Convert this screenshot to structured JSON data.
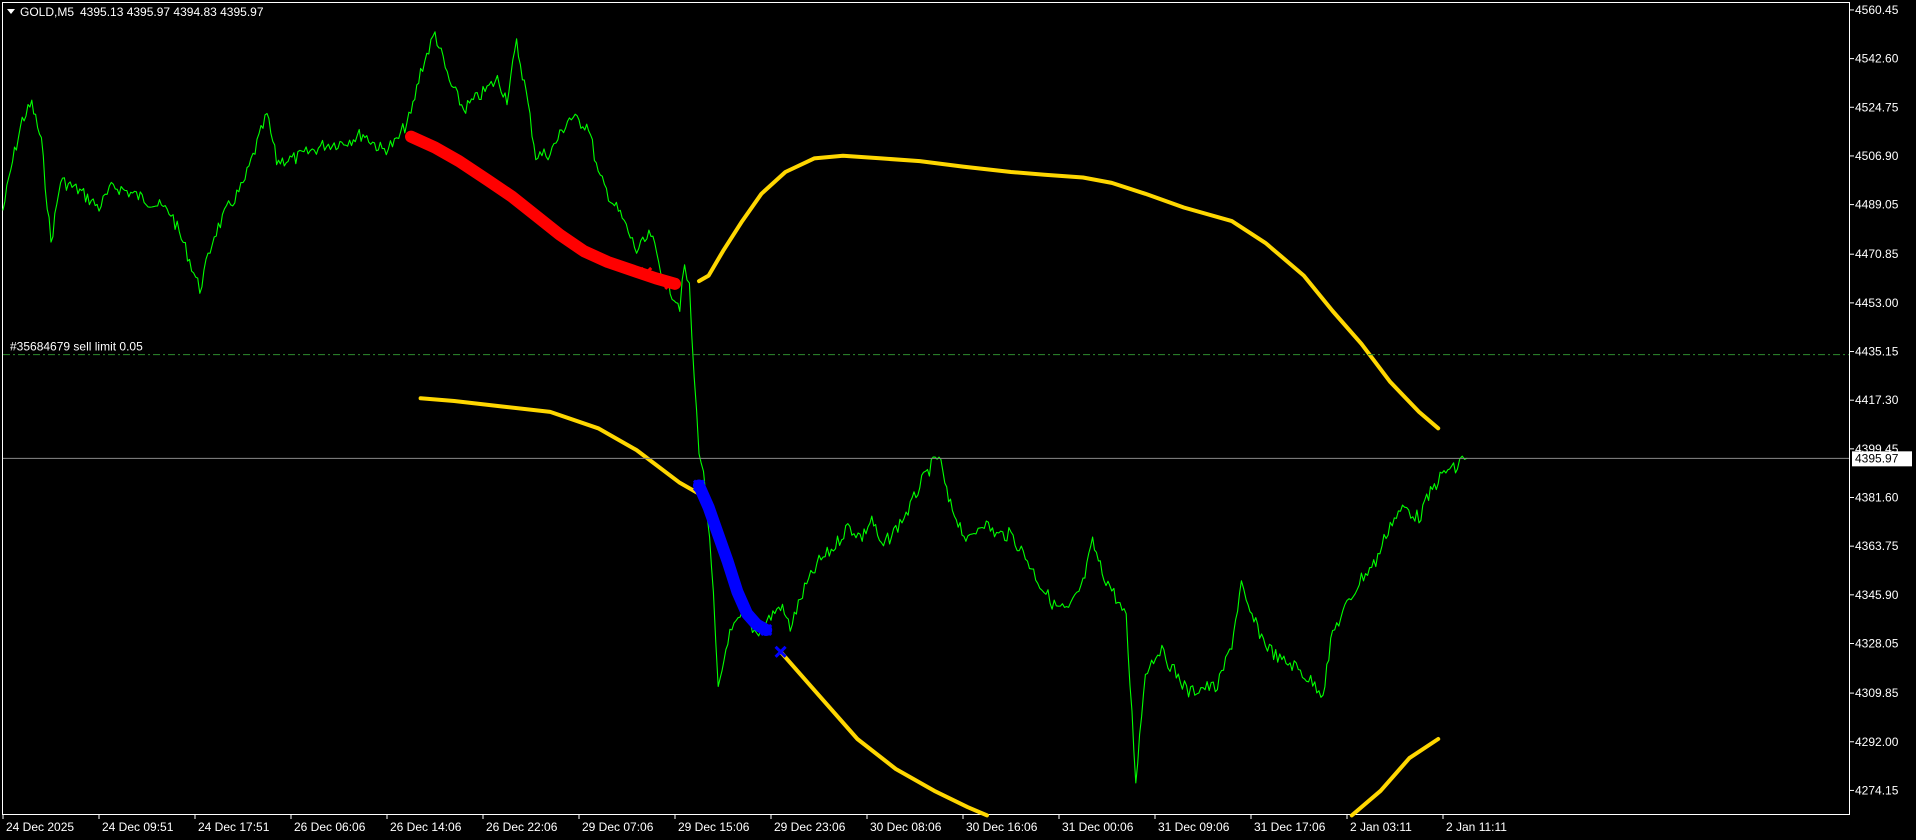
{
  "header": {
    "symbol": "GOLD,M5",
    "ohlc": "4395.13 4395.97 4394.83 4395.97"
  },
  "order_line": {
    "label": "#35684679 sell limit 0.05",
    "price": 4434.0,
    "color": "#2e8b2e"
  },
  "current_price": {
    "label": "4395.97",
    "value": 4395.97
  },
  "chart_data": {
    "type": "line",
    "title": "",
    "ylim": [
      4265.5,
      4563.0
    ],
    "grid": false,
    "y_ticks": [
      4560.45,
      4542.6,
      4524.75,
      4506.9,
      4489.05,
      4470.85,
      4453.0,
      4435.15,
      4417.3,
      4399.45,
      4381.6,
      4363.75,
      4345.9,
      4328.05,
      4309.85,
      4292.0,
      4274.15
    ],
    "y_tick_labels": [
      "4560.45",
      "4542.60",
      "4524.75",
      "4506.90",
      "4489.05",
      "4470.85",
      "4453.00",
      "4435.15",
      "4417.30",
      "4399.45",
      "4381.60",
      "4363.75",
      "4345.90",
      "4328.05",
      "4309.85",
      "4292.00",
      "4274.15"
    ],
    "x_tick_labels": [
      "24 Dec 2025",
      "24 Dec 09:51",
      "24 Dec 17:51",
      "26 Dec 06:06",
      "26 Dec 14:06",
      "26 Dec 22:06",
      "29 Dec 07:06",
      "29 Dec 15:06",
      "29 Dec 23:06",
      "30 Dec 08:06",
      "30 Dec 16:06",
      "31 Dec 00:06",
      "31 Dec 09:06",
      "31 Dec 17:06",
      "2 Jan 03:11",
      "2 Jan 11:11"
    ],
    "x_count": 15.4,
    "series": [
      {
        "color": "#00ff00",
        "width": 1.1,
        "points": [
          [
            0.0,
            4487
          ],
          [
            0.1,
            4505
          ],
          [
            0.2,
            4520
          ],
          [
            0.3,
            4526
          ],
          [
            0.4,
            4512
          ],
          [
            0.5,
            4475
          ],
          [
            0.6,
            4498
          ],
          [
            0.8,
            4494
          ],
          [
            1.0,
            4488
          ],
          [
            1.15,
            4496
          ],
          [
            1.35,
            4493
          ],
          [
            1.55,
            4490
          ],
          [
            1.75,
            4486
          ],
          [
            1.9,
            4473
          ],
          [
            2.05,
            4458
          ],
          [
            2.2,
            4478
          ],
          [
            2.35,
            4488
          ],
          [
            2.5,
            4496
          ],
          [
            2.75,
            4522
          ],
          [
            2.85,
            4505
          ],
          [
            3.05,
            4506
          ],
          [
            3.35,
            4511
          ],
          [
            3.55,
            4512
          ],
          [
            3.75,
            4515
          ],
          [
            3.95,
            4509
          ],
          [
            4.1,
            4512
          ],
          [
            4.25,
            4522
          ],
          [
            4.35,
            4538
          ],
          [
            4.5,
            4552
          ],
          [
            4.65,
            4534
          ],
          [
            4.8,
            4524
          ],
          [
            5.0,
            4530
          ],
          [
            5.15,
            4535
          ],
          [
            5.25,
            4528
          ],
          [
            5.35,
            4548
          ],
          [
            5.45,
            4530
          ],
          [
            5.55,
            4507
          ],
          [
            5.7,
            4508
          ],
          [
            5.9,
            4521
          ],
          [
            6.1,
            4518
          ],
          [
            6.2,
            4500
          ],
          [
            6.35,
            4490
          ],
          [
            6.45,
            4484
          ],
          [
            6.6,
            4472
          ],
          [
            6.75,
            4478
          ],
          [
            6.85,
            4465
          ],
          [
            6.95,
            4458
          ],
          [
            7.05,
            4452
          ],
          [
            7.1,
            4466
          ],
          [
            7.15,
            4458
          ],
          [
            7.2,
            4425
          ],
          [
            7.25,
            4400
          ],
          [
            7.32,
            4384
          ],
          [
            7.4,
            4345
          ],
          [
            7.45,
            4310
          ],
          [
            7.55,
            4330
          ],
          [
            7.7,
            4338
          ],
          [
            7.85,
            4332
          ],
          [
            8.0,
            4338
          ],
          [
            8.1,
            4342
          ],
          [
            8.2,
            4334
          ],
          [
            8.35,
            4348
          ],
          [
            8.5,
            4358
          ],
          [
            8.65,
            4363
          ],
          [
            8.8,
            4371
          ],
          [
            8.95,
            4367
          ],
          [
            9.05,
            4374
          ],
          [
            9.15,
            4363
          ],
          [
            9.3,
            4370
          ],
          [
            9.45,
            4378
          ],
          [
            9.55,
            4386
          ],
          [
            9.65,
            4392
          ],
          [
            9.75,
            4397
          ],
          [
            9.85,
            4380
          ],
          [
            9.95,
            4373
          ],
          [
            10.05,
            4365
          ],
          [
            10.2,
            4373
          ],
          [
            10.35,
            4368
          ],
          [
            10.5,
            4368
          ],
          [
            10.65,
            4360
          ],
          [
            10.8,
            4350
          ],
          [
            10.95,
            4342
          ],
          [
            11.1,
            4340
          ],
          [
            11.25,
            4350
          ],
          [
            11.35,
            4365
          ],
          [
            11.45,
            4354
          ],
          [
            11.55,
            4348
          ],
          [
            11.7,
            4337
          ],
          [
            11.8,
            4278
          ],
          [
            11.9,
            4318
          ],
          [
            12.05,
            4326
          ],
          [
            12.2,
            4318
          ],
          [
            12.35,
            4310
          ],
          [
            12.5,
            4312
          ],
          [
            12.65,
            4312
          ],
          [
            12.8,
            4328
          ],
          [
            12.9,
            4350
          ],
          [
            12.95,
            4342
          ],
          [
            13.05,
            4335
          ],
          [
            13.15,
            4328
          ],
          [
            13.3,
            4322
          ],
          [
            13.45,
            4320
          ],
          [
            13.6,
            4315
          ],
          [
            13.75,
            4310
          ],
          [
            13.85,
            4332
          ],
          [
            14.0,
            4342
          ],
          [
            14.15,
            4352
          ],
          [
            14.3,
            4358
          ],
          [
            14.45,
            4372
          ],
          [
            14.6,
            4378
          ],
          [
            14.75,
            4374
          ],
          [
            14.85,
            4382
          ],
          [
            14.95,
            4388
          ],
          [
            15.05,
            4392
          ],
          [
            15.15,
            4392
          ],
          [
            15.2,
            4397
          ],
          [
            15.25,
            4396
          ]
        ]
      },
      {
        "color": "#ffd700",
        "width": 4,
        "points": [
          [
            7.25,
            4461
          ],
          [
            7.35,
            4463
          ],
          [
            7.5,
            4472
          ],
          [
            7.7,
            4483
          ],
          [
            7.9,
            4493
          ],
          [
            8.15,
            4501
          ],
          [
            8.45,
            4506
          ],
          [
            8.75,
            4507
          ],
          [
            9.15,
            4506
          ],
          [
            9.55,
            4505
          ],
          [
            10.0,
            4503
          ],
          [
            10.5,
            4501
          ],
          [
            10.85,
            4500
          ],
          [
            11.25,
            4499
          ],
          [
            11.55,
            4497
          ],
          [
            11.9,
            4493
          ],
          [
            12.3,
            4488
          ],
          [
            12.8,
            4483
          ],
          [
            13.15,
            4475
          ],
          [
            13.55,
            4463
          ],
          [
            13.85,
            4450
          ],
          [
            14.15,
            4438
          ],
          [
            14.45,
            4424
          ],
          [
            14.75,
            4413
          ],
          [
            14.95,
            4407
          ]
        ]
      },
      {
        "color": "#ffd700",
        "width": 4,
        "points": [
          [
            4.35,
            4418
          ],
          [
            4.7,
            4417
          ],
          [
            5.2,
            4415
          ],
          [
            5.7,
            4413
          ],
          [
            6.2,
            4407
          ],
          [
            6.6,
            4399
          ],
          [
            7.05,
            4387
          ],
          [
            7.25,
            4383
          ]
        ]
      },
      {
        "color": "#ffd700",
        "width": 4,
        "points": [
          [
            8.1,
            4325
          ],
          [
            8.5,
            4309
          ],
          [
            8.9,
            4293
          ],
          [
            9.3,
            4282
          ],
          [
            9.7,
            4274
          ],
          [
            10.05,
            4268
          ],
          [
            10.25,
            4265
          ]
        ]
      },
      {
        "color": "#ffd700",
        "width": 4,
        "points": [
          [
            14.05,
            4265
          ],
          [
            14.35,
            4274
          ],
          [
            14.65,
            4286
          ],
          [
            14.95,
            4293
          ]
        ]
      },
      {
        "color": "#ff0000",
        "width": 12,
        "points": [
          [
            4.25,
            4514
          ],
          [
            4.5,
            4510
          ],
          [
            4.75,
            4505
          ],
          [
            5.05,
            4498
          ],
          [
            5.3,
            4492
          ],
          [
            5.55,
            4485
          ],
          [
            5.8,
            4478
          ],
          [
            6.05,
            4472
          ],
          [
            6.3,
            4468
          ],
          [
            6.55,
            4465
          ],
          [
            6.8,
            4462
          ],
          [
            7.0,
            4460
          ]
        ]
      },
      {
        "color": "#0000ff",
        "width": 12,
        "points": [
          [
            7.25,
            4386
          ],
          [
            7.35,
            4378
          ],
          [
            7.45,
            4368
          ],
          [
            7.55,
            4358
          ],
          [
            7.65,
            4347
          ],
          [
            7.75,
            4339
          ],
          [
            7.85,
            4335
          ],
          [
            7.95,
            4333
          ]
        ]
      }
    ],
    "markers": [
      {
        "color": "#ff0000",
        "x": 6.7,
        "y": 4464
      },
      {
        "color": "#ff0000",
        "x": 6.95,
        "y": 4460
      },
      {
        "color": "#0000ff",
        "x": 7.25,
        "y": 4386
      },
      {
        "color": "#0000ff",
        "x": 7.95,
        "y": 4333
      },
      {
        "color": "#0000ff",
        "x": 8.1,
        "y": 4325
      }
    ]
  }
}
